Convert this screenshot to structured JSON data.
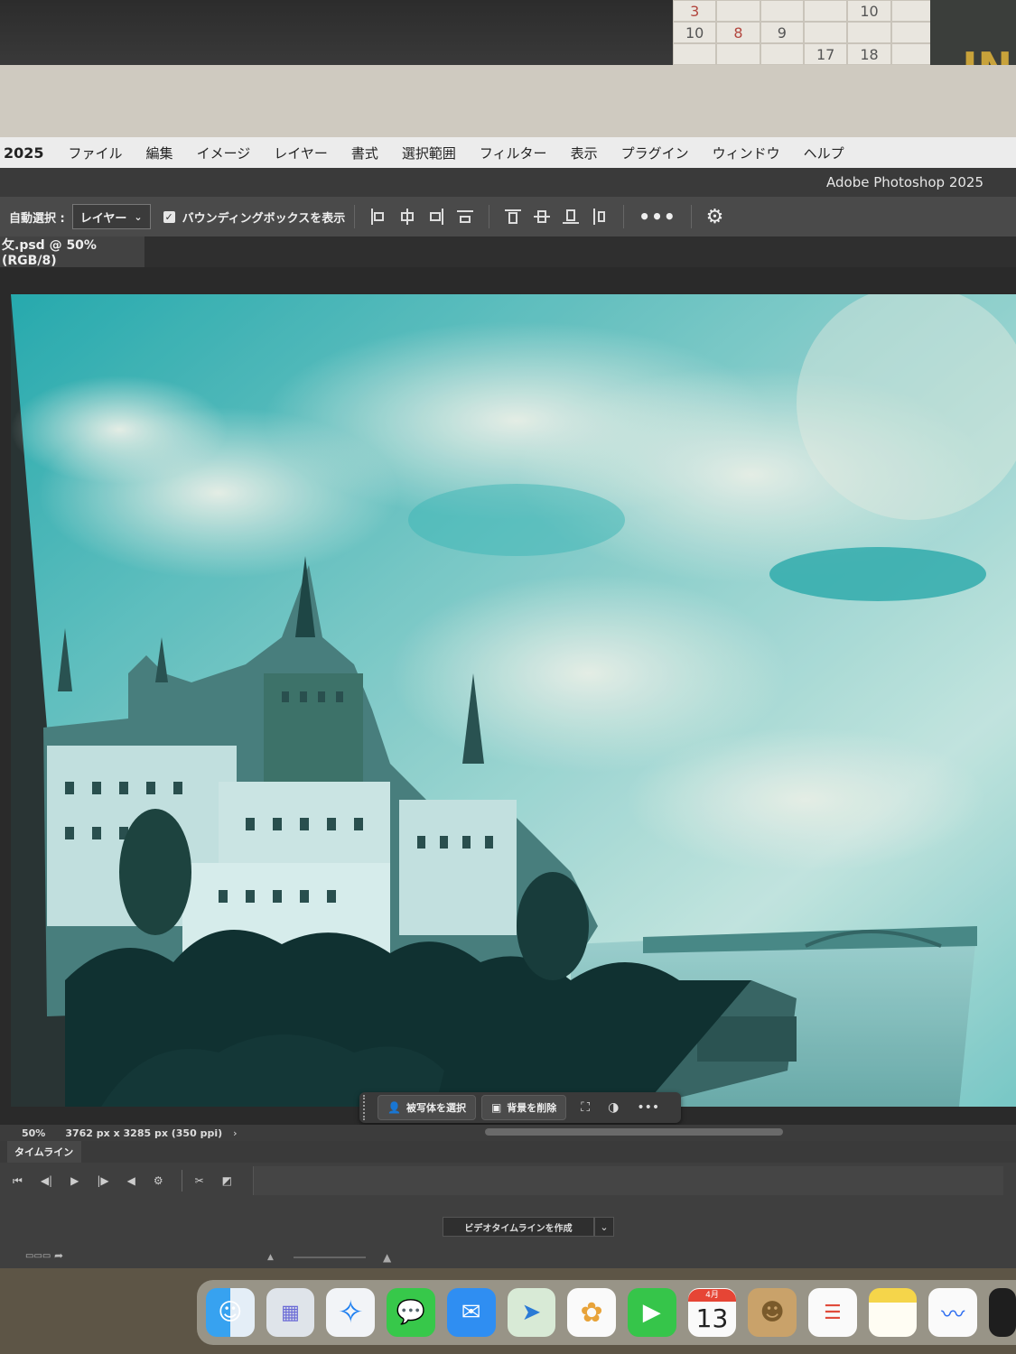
{
  "menubar": {
    "app_year": "2025",
    "items": [
      "ファイル",
      "編集",
      "イメージ",
      "レイヤー",
      "書式",
      "選択範囲",
      "フィルター",
      "表示",
      "プラグイン",
      "ウィンドウ",
      "ヘルプ"
    ]
  },
  "window": {
    "title": "Adobe Photoshop 2025"
  },
  "options_bar": {
    "auto_select_label": "自動選択 :",
    "layer_select_value": "レイヤー",
    "bounding_box_label": "バウンディングボックスを表示",
    "bounding_box_checked": true
  },
  "document_tab": {
    "label": "攵.psd @ 50% (RGB/8)"
  },
  "context_bar": {
    "select_subject_label": "被写体を選択",
    "remove_background_label": "背景を削除"
  },
  "status_bar": {
    "zoom": "50%",
    "dimensions": "3762 px x 3285 px (350 ppi)"
  },
  "timeline": {
    "tab_label": "タイムライン",
    "create_button_label": "ビデオタイムラインを作成"
  },
  "calendar_wall": {
    "cells": [
      "3",
      "",
      "",
      "",
      "10",
      "",
      "10",
      "8",
      "9",
      "",
      "",
      "",
      "",
      "",
      "",
      "17",
      "18",
      ""
    ]
  },
  "badge_text": "IN",
  "dock": {
    "calendar_month": "4月",
    "calendar_day": "13"
  },
  "colors": {
    "sky_teal": "#2fb3b3",
    "photoshop_panel": "#3a3a3a",
    "menubar_bg": "#ececec"
  }
}
